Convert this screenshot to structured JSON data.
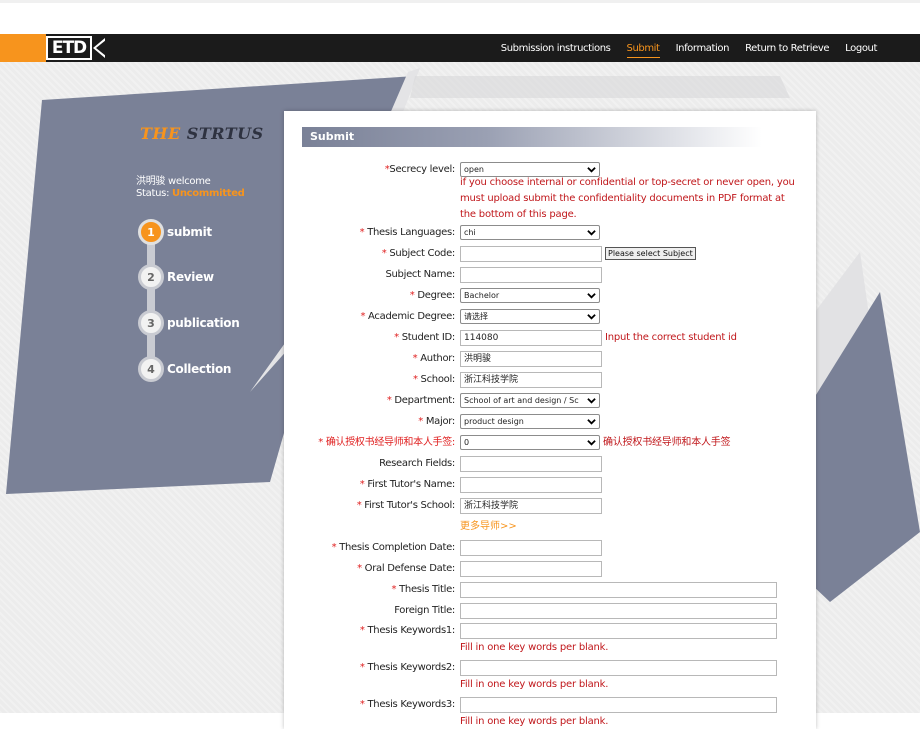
{
  "nav": {
    "logo": "ETD",
    "links": [
      "Submission instructions",
      "Submit",
      "Information",
      "Return to Retrieve",
      "Logout"
    ],
    "active_link": "Submit"
  },
  "sidebar": {
    "brand_the": "THE",
    "brand_rest": " STRTUS",
    "welcome": "洪明骏 welcome",
    "status_label": "Status:",
    "status_value": "Uncommitted",
    "steps": [
      {
        "num": "1",
        "label": "submit"
      },
      {
        "num": "2",
        "label": "Review"
      },
      {
        "num": "3",
        "label": "publication"
      },
      {
        "num": "4",
        "label": "Collection"
      }
    ]
  },
  "form": {
    "header": "Submit",
    "secrecy": {
      "label": "Secrecy level:",
      "value": "open",
      "note": "if you choose internal or confidential or top-secret or never open, you must upload submit the confidentiality documents in PDF format at the bottom of this page."
    },
    "thesis_languages": {
      "label": "Thesis Languages:",
      "value": "chi"
    },
    "subject_code": {
      "label": "Subject Code:",
      "value": "",
      "button": "Please select Subject"
    },
    "subject_name": {
      "label": "Subject Name:",
      "value": ""
    },
    "degree": {
      "label": "Degree:",
      "value": "Bachelor"
    },
    "academic_degree": {
      "label": "Academic Degree:",
      "value": "请选择"
    },
    "student_id": {
      "label": "Student ID:",
      "value": "114080",
      "note": "Input the correct student id"
    },
    "author": {
      "label": "Author:",
      "value": "洪明骏"
    },
    "school": {
      "label": "School:",
      "value": "浙江科技学院"
    },
    "department": {
      "label": "Department:",
      "value": "School of art and design / Sc"
    },
    "major": {
      "label": "Major:",
      "value": "product design"
    },
    "confirm_auth": {
      "label": "确认授权书经导师和本人手签:",
      "value": "0",
      "note": "确认授权书经导师和本人手签"
    },
    "research_fields": {
      "label": "Research Fields:",
      "value": ""
    },
    "first_tutor_name": {
      "label": "First Tutor's Name:",
      "value": ""
    },
    "first_tutor_school": {
      "label": "First Tutor's School:",
      "value": "浙江科技学院"
    },
    "more_tutors": "更多导师>>",
    "completion_date": {
      "label": "Thesis Completion Date:",
      "value": ""
    },
    "defense_date": {
      "label": "Oral Defense Date:",
      "value": ""
    },
    "thesis_title": {
      "label": "Thesis Title:",
      "value": ""
    },
    "foreign_title": {
      "label": "Foreign Title:",
      "value": ""
    },
    "keywords1": {
      "label": "Thesis Keywords1:",
      "value": "",
      "note": "Fill in one key words per blank."
    },
    "keywords2": {
      "label": "Thesis Keywords2:",
      "value": "",
      "note": "Fill in one key words per blank."
    },
    "keywords3": {
      "label": "Thesis Keywords3:",
      "value": "",
      "note": "Fill in one key words per blank."
    }
  },
  "colors": {
    "accent": "#f7941d",
    "navbar": "#1b1b1b",
    "slate": "#7a8197",
    "error": "#c0171b"
  }
}
